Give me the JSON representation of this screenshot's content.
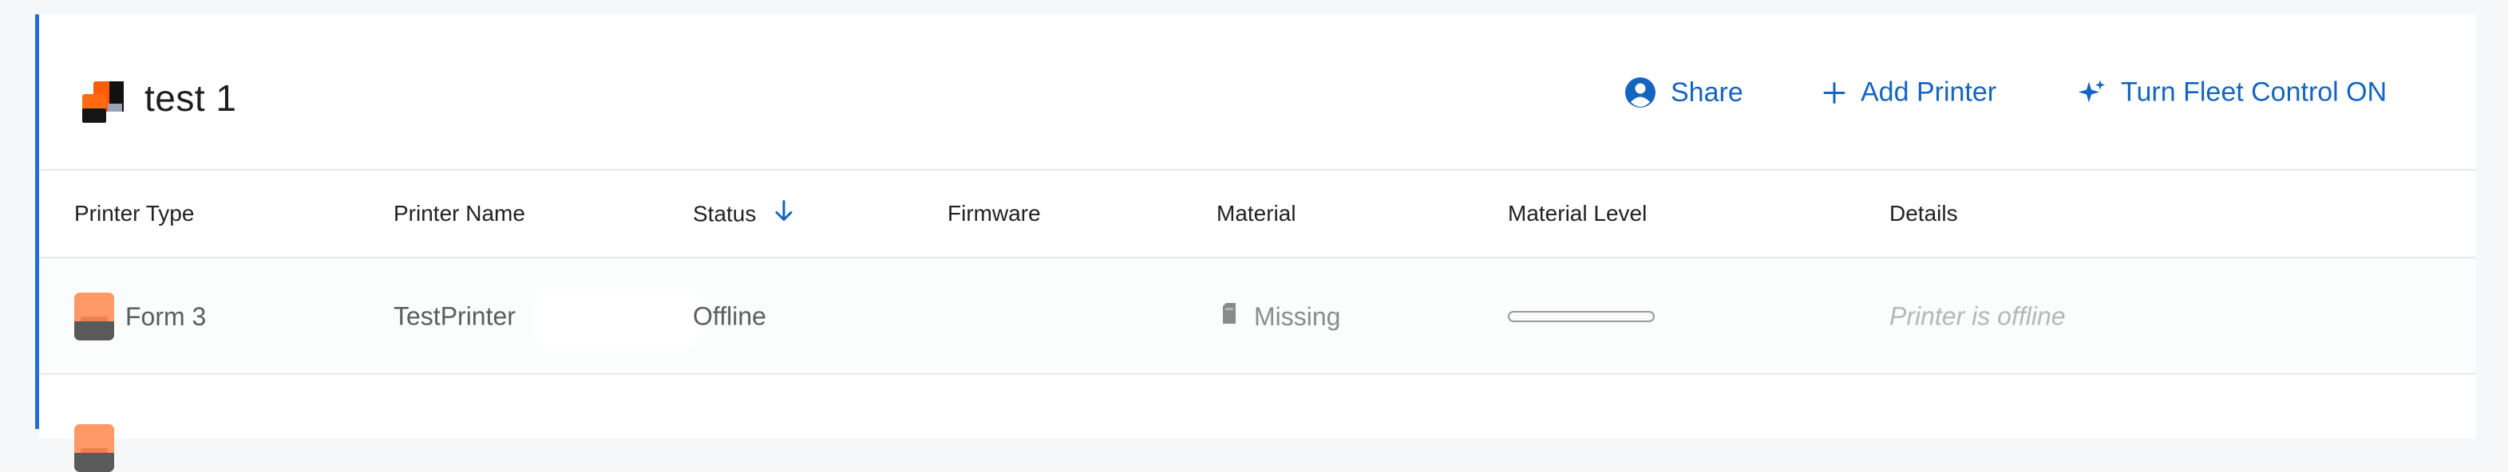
{
  "group": {
    "title": "test 1",
    "logo_icon": "printer-stack-icon"
  },
  "actions": {
    "share": {
      "label": "Share",
      "icon": "user-circle-icon"
    },
    "add_printer": {
      "label": "Add Printer",
      "icon": "plus-icon"
    },
    "fleet_control": {
      "label": "Turn Fleet Control ON",
      "icon": "sparkle-icon"
    }
  },
  "table": {
    "columns": {
      "printer_type": "Printer Type",
      "printer_name": "Printer Name",
      "status": "Status",
      "status_sort": "arrow-down-icon",
      "firmware": "Firmware",
      "material": "Material",
      "material_level": "Material Level",
      "details": "Details"
    },
    "rows": [
      {
        "printer_type": "Form 3",
        "printer_name": "TestPrinter",
        "status": "Offline",
        "firmware": "",
        "material": "Missing",
        "material_icon": "cartridge-icon",
        "material_level": 0,
        "details": "Printer is offline"
      }
    ]
  },
  "colors": {
    "accent": "#1565c0",
    "left_border": "#1f6fd6",
    "brand_orange": "#ff6a13"
  }
}
